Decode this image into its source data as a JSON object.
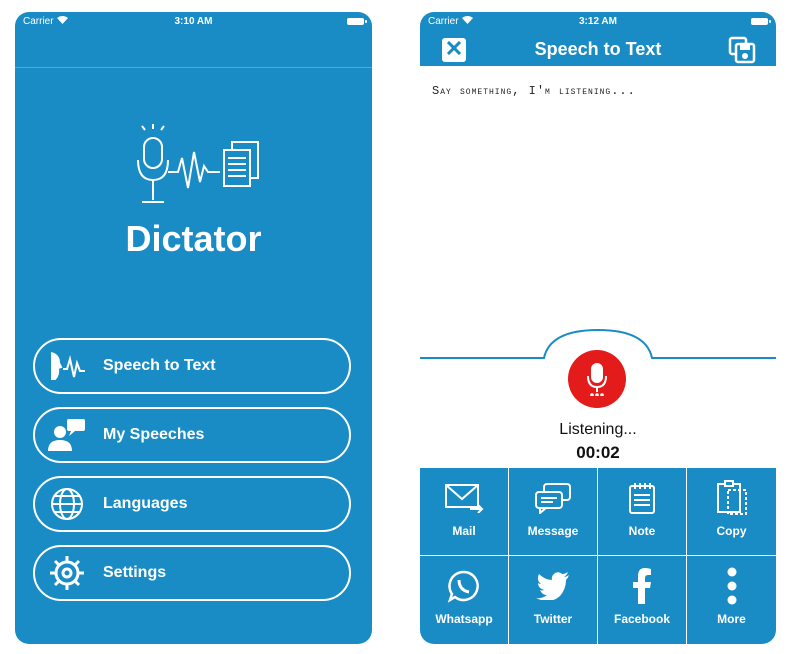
{
  "left_screen": {
    "status": {
      "carrier": "Carrier",
      "time": "3:10 AM"
    },
    "app_title": "Dictator",
    "menu": [
      {
        "label": "Speech to Text",
        "icon": "speech-wave-icon"
      },
      {
        "label": "My Speeches",
        "icon": "user-chat-icon"
      },
      {
        "label": "Languages",
        "icon": "globe-icon"
      },
      {
        "label": "Settings",
        "icon": "gear-icon"
      }
    ]
  },
  "right_screen": {
    "status": {
      "carrier": "Carrier",
      "time": "3:12 AM"
    },
    "header_title": "Speech to Text",
    "prompt": "Say something, I'm listening...",
    "listening_text": "Listening...",
    "timer": "00:02",
    "share_options": [
      {
        "label": "Mail",
        "icon": "mail-icon"
      },
      {
        "label": "Message",
        "icon": "message-icon"
      },
      {
        "label": "Note",
        "icon": "note-icon"
      },
      {
        "label": "Copy",
        "icon": "copy-icon"
      },
      {
        "label": "Whatsapp",
        "icon": "whatsapp-icon"
      },
      {
        "label": "Twitter",
        "icon": "twitter-icon"
      },
      {
        "label": "Facebook",
        "icon": "facebook-icon"
      },
      {
        "label": "More",
        "icon": "more-icon"
      }
    ]
  },
  "colors": {
    "primary": "#1a8cc5",
    "record": "#e31b1b",
    "white": "#ffffff"
  }
}
